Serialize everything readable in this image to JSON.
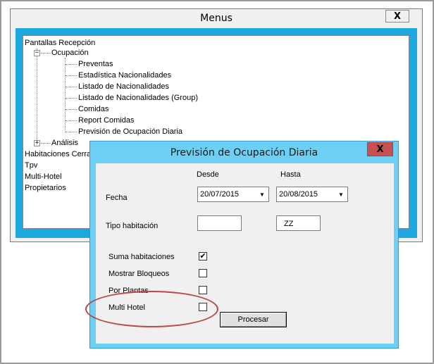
{
  "menus_window": {
    "title": "Menus",
    "close_glyph": "X",
    "tree": {
      "root": "Pantallas Recepción",
      "ocupacion": {
        "label": "Ocupación",
        "expander": "−",
        "children": [
          "Preventas",
          "Estadística Nacionalidades",
          "Listado de Nacionalidades",
          "Listado de Nacionalidades (Group)",
          "Comidas",
          "Report Comidas",
          "Previsión de Ocupación Diaria"
        ]
      },
      "analisis": {
        "label": "Análisis",
        "expander": "+"
      },
      "other_roots": [
        "Habitaciones Cerrad",
        "Tpv",
        "Multi-Hotel",
        "Propietarios"
      ]
    }
  },
  "dialog": {
    "title": "Previsión de Ocupación Diaria",
    "close_glyph": "X",
    "desde_label": "Desde",
    "hasta_label": "Hasta",
    "fecha_label": "Fecha",
    "fecha_desde": "20/07/2015",
    "fecha_hasta": "20/08/2015",
    "tipo_habitacion_label": "Tipo habitación",
    "tipo_desde": "",
    "tipo_hasta": "ZZ",
    "dropdown_glyph": "▼",
    "options": [
      {
        "label": "Suma habitaciones",
        "checked": true,
        "mark": "✔"
      },
      {
        "label": "Mostrar Bloqueos",
        "checked": false,
        "mark": ""
      },
      {
        "label": "Por Plantas",
        "checked": false,
        "mark": ""
      },
      {
        "label": "Multi Hotel",
        "checked": false,
        "mark": ""
      }
    ],
    "procesar_label": "Procesar"
  },
  "colors": {
    "menus_accent": "#1ca7e0",
    "dialog_frame": "#6ecff5",
    "close_red": "#c75050",
    "annotation": "#b84848"
  }
}
